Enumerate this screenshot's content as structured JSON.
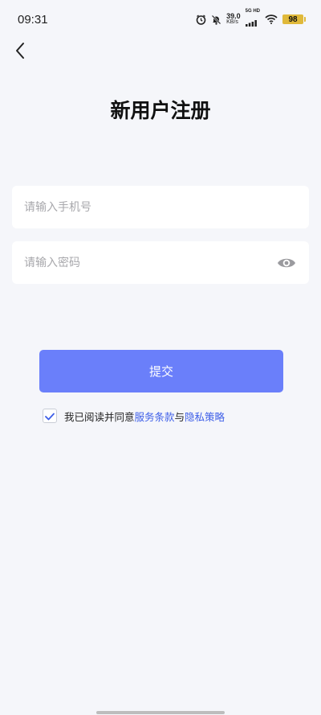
{
  "status_bar": {
    "time": "09:31",
    "net_speed_value": "39.0",
    "net_speed_unit": "KB/s",
    "signal_label": "5G HD",
    "battery": "98",
    "battery_color": "#e0b93a"
  },
  "header": {
    "title": "新用户注册"
  },
  "form": {
    "phone_placeholder": "请输入手机号",
    "password_placeholder": "请输入密码",
    "submit_label": "提交"
  },
  "agreement": {
    "checked": true,
    "prefix": "我已阅读并同意",
    "terms_link": "服务条款",
    "joiner": "与",
    "privacy_link": "隐私策略"
  },
  "colors": {
    "accent": "#6a7ffa",
    "link": "#3d5ee8",
    "background": "#f5f6fa"
  },
  "icons": [
    "back-arrow-icon",
    "alarm-icon",
    "bell-off-icon",
    "signal-icon",
    "wifi-icon",
    "battery-icon",
    "eye-icon",
    "checkmark-icon"
  ]
}
